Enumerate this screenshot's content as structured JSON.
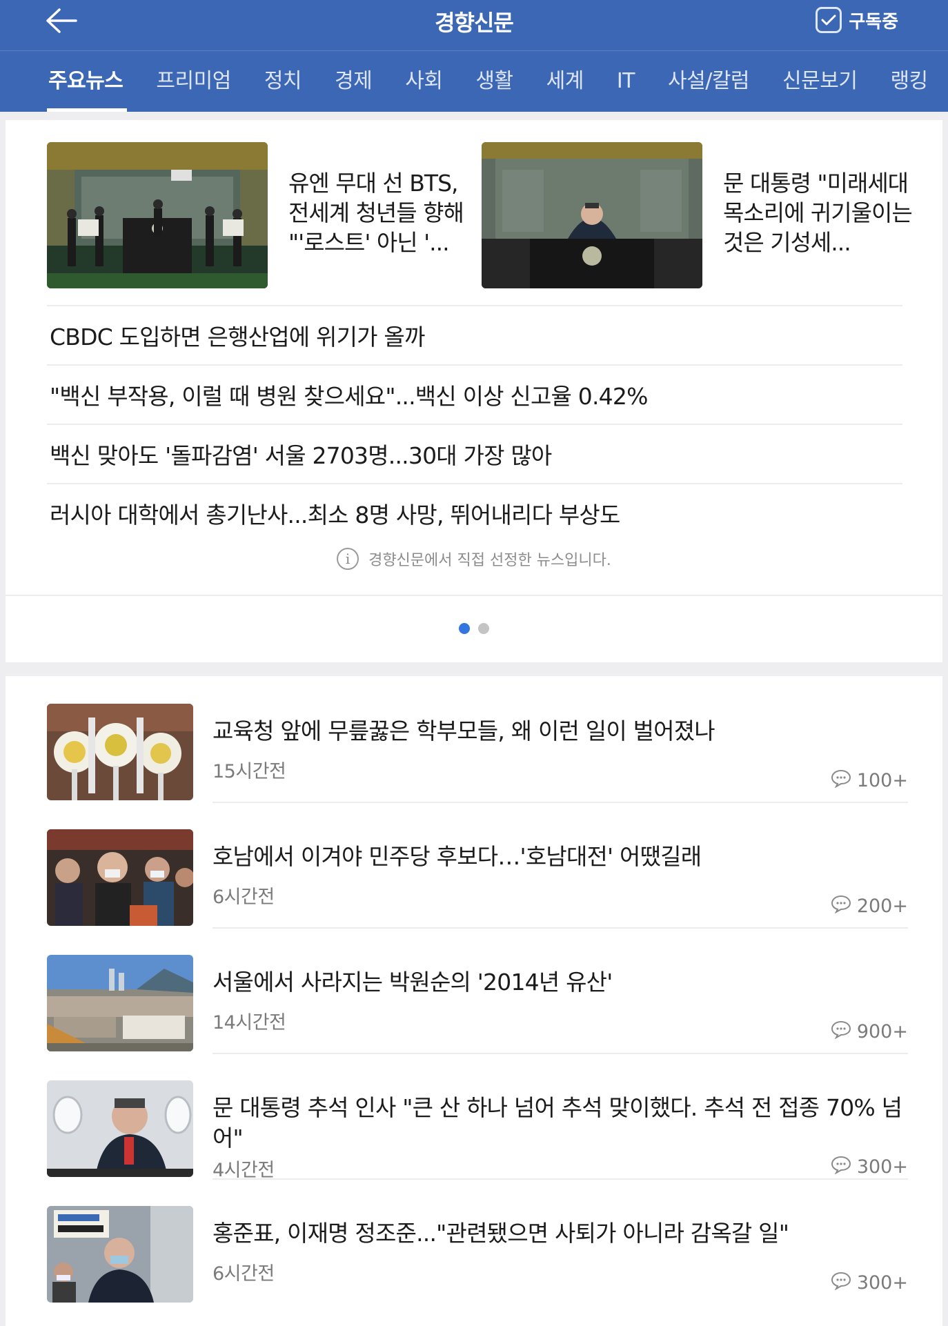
{
  "header": {
    "brand": "경향신문",
    "subscribe_label": "구독중"
  },
  "tabs": [
    {
      "label": "주요뉴스"
    },
    {
      "label": "프리미엄"
    },
    {
      "label": "정치"
    },
    {
      "label": "경제"
    },
    {
      "label": "사회"
    },
    {
      "label": "생활"
    },
    {
      "label": "세계"
    },
    {
      "label": "IT"
    },
    {
      "label": "사설/칼럼"
    },
    {
      "label": "신문보기"
    },
    {
      "label": "랭킹"
    }
  ],
  "featured": [
    {
      "title": "유엔 무대 선 BTS, 전세계 청년들 향해 \"'로스트' 아닌 '..."
    },
    {
      "title": "문 대통령 \"미래세대 목소리에 귀기울이는 것은 기성세..."
    }
  ],
  "headlines": [
    {
      "title": "CBDC 도입하면 은행산업에 위기가 올까"
    },
    {
      "title": "\"백신 부작용, 이럴 때 병원 찾으세요\"...백신 이상 신고율 0.42%"
    },
    {
      "title": "백신 맞아도 '돌파감염' 서울 2703명...30대 가장 많아"
    },
    {
      "title": "러시아 대학에서 총기난사...최소 8명 사망, 뛰어내리다 부상도"
    }
  ],
  "notice": "경향신문에서 직접 선정한 뉴스입니다.",
  "pager": {
    "total": 2,
    "active": 0
  },
  "articles": [
    {
      "title": "교육청 앞에 무릎꿇은 학부모들, 왜 이런 일이 벌어졌나",
      "time": "15시간전",
      "comments": "100+"
    },
    {
      "title": "호남에서 이겨야 민주당 후보다…'호남대전' 어땠길래",
      "time": "6시간전",
      "comments": "200+"
    },
    {
      "title": "서울에서 사라지는 박원순의 '2014년 유산'",
      "time": "14시간전",
      "comments": "900+"
    },
    {
      "title": "문 대통령 추석 인사 \"큰 산 하나 넘어 추석 맞이했다. 추석 전 접종 70% 넘어\"",
      "time": "4시간전",
      "comments": "300+"
    },
    {
      "title": "홍준표, 이재명 정조준...\"관련됐으면 사퇴가 아니라 감옥갈 일\"",
      "time": "6시간전",
      "comments": "300+"
    }
  ],
  "colors": {
    "brand_blue": "#3c67b4",
    "dot_active": "#3376e0"
  }
}
